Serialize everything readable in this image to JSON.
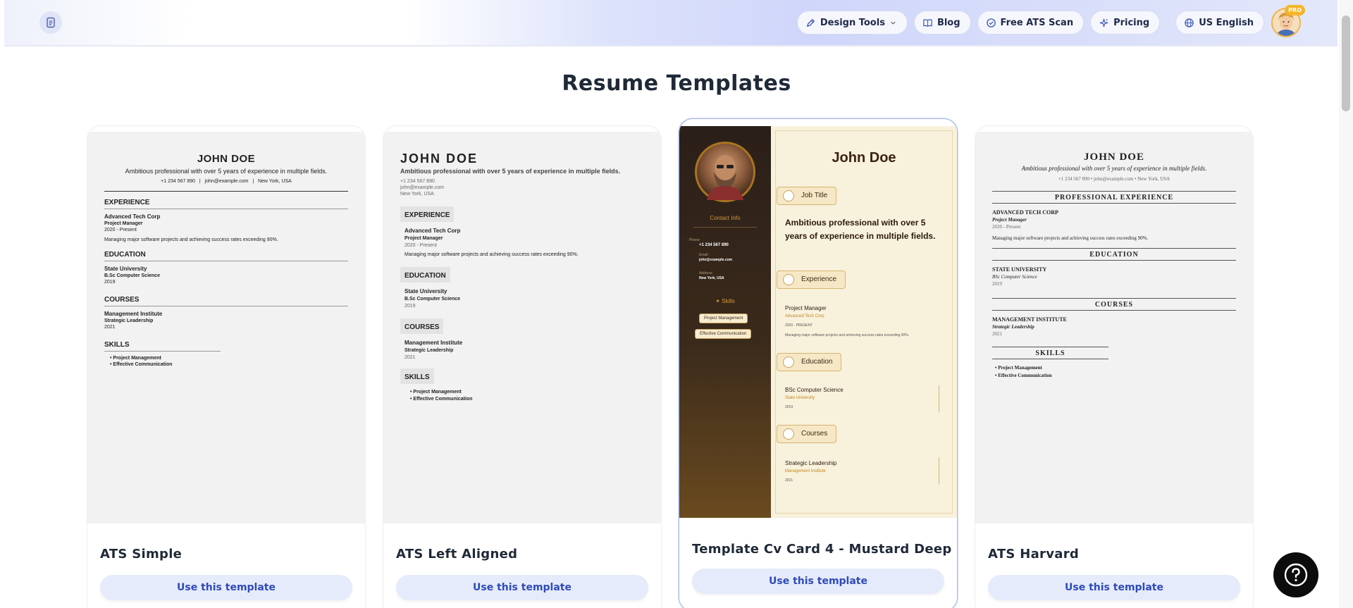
{
  "header": {
    "nav": [
      {
        "id": "design-tools",
        "label": "Design Tools",
        "icon": "pen-icon",
        "has_dropdown": true
      },
      {
        "id": "blog",
        "label": "Blog",
        "icon": "book-icon"
      },
      {
        "id": "free-ats-scan",
        "label": "Free ATS Scan",
        "icon": "check-circle-icon"
      },
      {
        "id": "pricing",
        "label": "Pricing",
        "icon": "sparkle-icon"
      },
      {
        "id": "language",
        "label": "US English",
        "icon": "globe-icon"
      }
    ],
    "badge": "PRO"
  },
  "page": {
    "title": "Resume Templates"
  },
  "cards": [
    {
      "name": "ATS Simple",
      "button": "Use this template"
    },
    {
      "name": "ATS Left Aligned",
      "button": "Use this template"
    },
    {
      "name": "Template Cv Card 4 - Mustard Deep",
      "button": "Use this template",
      "selected": true
    },
    {
      "name": "ATS Harvard",
      "button": "Use this template"
    }
  ],
  "resume": {
    "name": "JOHN DOE",
    "name_title_case": "John Doe",
    "summary": "Ambitious professional with over 5 years of experience in multiple fields.",
    "phone": "+1 234 567 890",
    "email": "john@example.com",
    "address": "New York, USA",
    "sections": {
      "experience": "EXPERIENCE",
      "education": "EDUCATION",
      "courses": "COURSES",
      "skills": "SKILLS",
      "professional_experience": "PROFESSIONAL EXPERIENCE"
    },
    "experience": {
      "company": "Advanced Tech Corp",
      "company_upper": "ADVANCED TECH CORP",
      "role": "Project Manager",
      "dates": "2020 - Present",
      "dates_upper": "2020 - PRESENT",
      "desc": "Managing major software projects and achieving success rates exceeding 90%."
    },
    "education": {
      "school": "State University",
      "school_upper": "STATE UNIVERSITY",
      "degree": "B.Sc Computer Science",
      "degree_alt": "BSc Computer Science",
      "year": "2019"
    },
    "courses": {
      "institute": "Management Institute",
      "institute_upper": "MANAGEMENT INSTITUTE",
      "course": "Strategic Leadership",
      "year": "2021"
    },
    "skills": [
      "Project Management",
      "Effective Communication"
    ],
    "mustard": {
      "contact_info": "Contact Info",
      "phone_label": "Phone:",
      "email_label": "Email:",
      "address_label": "Address:",
      "skills_label": "Skills",
      "job_title": "Job Title",
      "experience": "Experience",
      "education": "Education",
      "courses": "Courses"
    }
  },
  "colors": {
    "accent": "#2e4bb8",
    "button_bg": "#e6ebfb",
    "mustard": "#a8741e",
    "mustard_dark": "#2a1f19"
  }
}
